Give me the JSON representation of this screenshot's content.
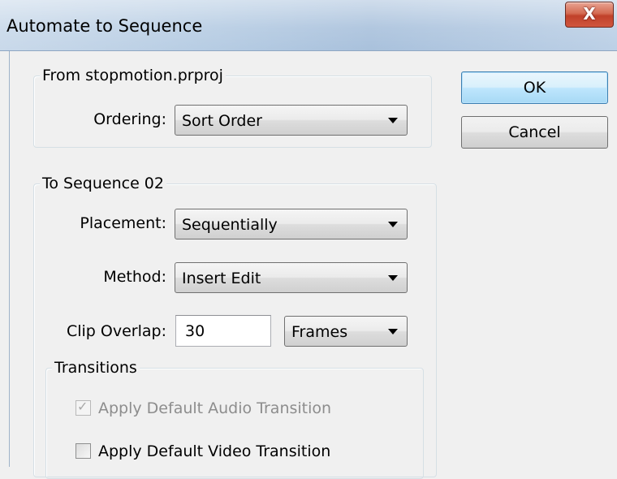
{
  "window": {
    "title": "Automate to Sequence",
    "close_glyph": "X"
  },
  "from_group": {
    "title": "From stopmotion.prproj",
    "ordering": {
      "label": "Ordering:",
      "value": "Sort Order"
    }
  },
  "to_group": {
    "title": "To Sequence 02",
    "placement": {
      "label": "Placement:",
      "value": "Sequentially"
    },
    "method": {
      "label": "Method:",
      "value": "Insert Edit"
    },
    "clip_overlap": {
      "label": "Clip Overlap:",
      "value": "30",
      "unit": "Frames"
    },
    "transitions": {
      "title": "Transitions",
      "audio": {
        "label": "Apply Default Audio Transition",
        "checked": true,
        "enabled": false,
        "check_glyph": "✓"
      },
      "video": {
        "label": "Apply Default Video Transition",
        "checked": false,
        "enabled": true
      }
    }
  },
  "buttons": {
    "ok": "OK",
    "cancel": "Cancel"
  },
  "icons": {
    "close": "close-icon",
    "dropdown": "chevron-down-icon",
    "checkmark": "checkmark-icon"
  }
}
